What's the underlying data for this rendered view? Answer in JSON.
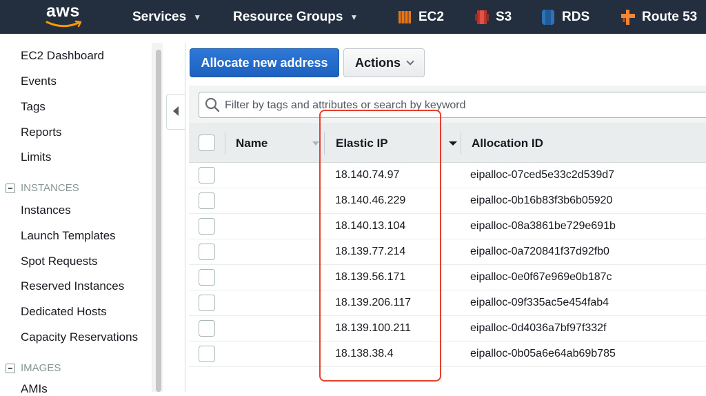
{
  "brand": {
    "logo_text": "aws",
    "logo_icon": "aws-smile-icon"
  },
  "topnav": {
    "services_label": "Services",
    "resource_groups_label": "Resource Groups",
    "shortcuts": [
      {
        "label": "EC2",
        "icon": "ec2-icon",
        "color": "#e47911"
      },
      {
        "label": "S3",
        "icon": "s3-icon",
        "color": "#c7312c"
      },
      {
        "label": "RDS",
        "icon": "rds-icon",
        "color": "#2e73b8"
      },
      {
        "label": "Route 53",
        "icon": "route53-icon",
        "color": "#f58536"
      }
    ]
  },
  "sidebar": {
    "items": [
      "EC2 Dashboard",
      "Events",
      "Tags",
      "Reports",
      "Limits"
    ],
    "instances_section": "INSTANCES",
    "instances_items": [
      "Instances",
      "Launch Templates",
      "Spot Requests",
      "Reserved Instances",
      "Dedicated Hosts",
      "Capacity Reservations"
    ],
    "images_section": "IMAGES",
    "images_items": [
      "AMIs"
    ]
  },
  "toolbar": {
    "allocate_label": "Allocate new address",
    "actions_label": "Actions"
  },
  "search": {
    "placeholder": "Filter by tags and attributes or search by keyword"
  },
  "table": {
    "columns": [
      "Name",
      "Elastic IP",
      "Allocation ID"
    ],
    "rows": [
      {
        "name": "",
        "elastic_ip": "18.140.74.97",
        "allocation_id": "eipalloc-07ced5e33c2d539d7"
      },
      {
        "name": "",
        "elastic_ip": "18.140.46.229",
        "allocation_id": "eipalloc-0b16b83f3b6b05920"
      },
      {
        "name": "",
        "elastic_ip": "18.140.13.104",
        "allocation_id": "eipalloc-08a3861be729e691b"
      },
      {
        "name": "",
        "elastic_ip": "18.139.77.214",
        "allocation_id": "eipalloc-0a720841f37d92fb0"
      },
      {
        "name": "",
        "elastic_ip": "18.139.56.171",
        "allocation_id": "eipalloc-0e0f67e969e0b187c"
      },
      {
        "name": "",
        "elastic_ip": "18.139.206.117",
        "allocation_id": "eipalloc-09f335ac5e454fab4"
      },
      {
        "name": "",
        "elastic_ip": "18.139.100.211",
        "allocation_id": "eipalloc-0d4036a7bf97f332f"
      },
      {
        "name": "",
        "elastic_ip": "18.138.38.4",
        "allocation_id": "eipalloc-0b05a6e64ab69b785"
      }
    ]
  },
  "colors": {
    "nav_bg": "#232f3e",
    "primary_button": "#1d61bf",
    "highlight_box": "#e5402f"
  }
}
